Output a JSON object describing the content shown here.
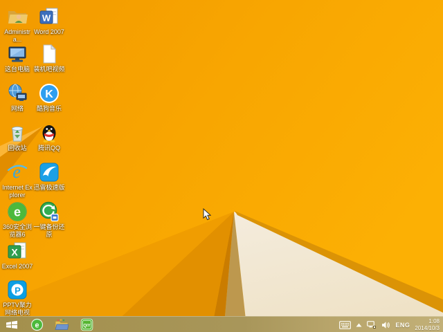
{
  "desktop_icons": {
    "col1": [
      {
        "label": "Administra...",
        "icon": "user-folder-icon"
      },
      {
        "label": "这台电脑",
        "icon": "this-pc-icon"
      },
      {
        "label": "网络",
        "icon": "network-icon"
      },
      {
        "label": "回收站",
        "icon": "recycle-bin-icon"
      },
      {
        "label": "Internet Explorer",
        "icon": "internet-explorer-icon"
      },
      {
        "label": "360安全浏览器6",
        "icon": "360-browser-icon"
      },
      {
        "label": "Excel 2007",
        "icon": "excel-icon"
      },
      {
        "label": "PPTV聚力 网络电视",
        "icon": "pptv-icon"
      }
    ],
    "col2": [
      {
        "label": "Word 2007",
        "icon": "word-icon"
      },
      {
        "label": "装机吧视频",
        "icon": "text-document-icon"
      },
      {
        "label": "酷狗音乐",
        "icon": "kugou-music-icon"
      },
      {
        "label": "腾讯QQ",
        "icon": "qq-icon"
      },
      {
        "label": "迅雷极速版",
        "icon": "thunder-icon"
      },
      {
        "label": "一键备份还原",
        "icon": "backup-restore-icon"
      }
    ]
  },
  "taskbar": {
    "buttons": [
      {
        "icon": "start-icon"
      },
      {
        "icon": "360-browser-icon"
      },
      {
        "icon": "file-explorer-icon"
      },
      {
        "icon": "iqiyi-icon"
      }
    ],
    "tray": {
      "icons": [
        "touch-keyboard-icon",
        "chevron-up-icon",
        "network-status-icon",
        "speaker-icon"
      ],
      "language": "ENG",
      "time": "1:08",
      "date": "2014/10/3"
    }
  },
  "colors": {
    "wallpaper_base": "#f8a601",
    "wallpaper_dark_facet": "#e29000",
    "wallpaper_cream": "#f2e8d6",
    "taskbar_tan": "#a8965a"
  }
}
